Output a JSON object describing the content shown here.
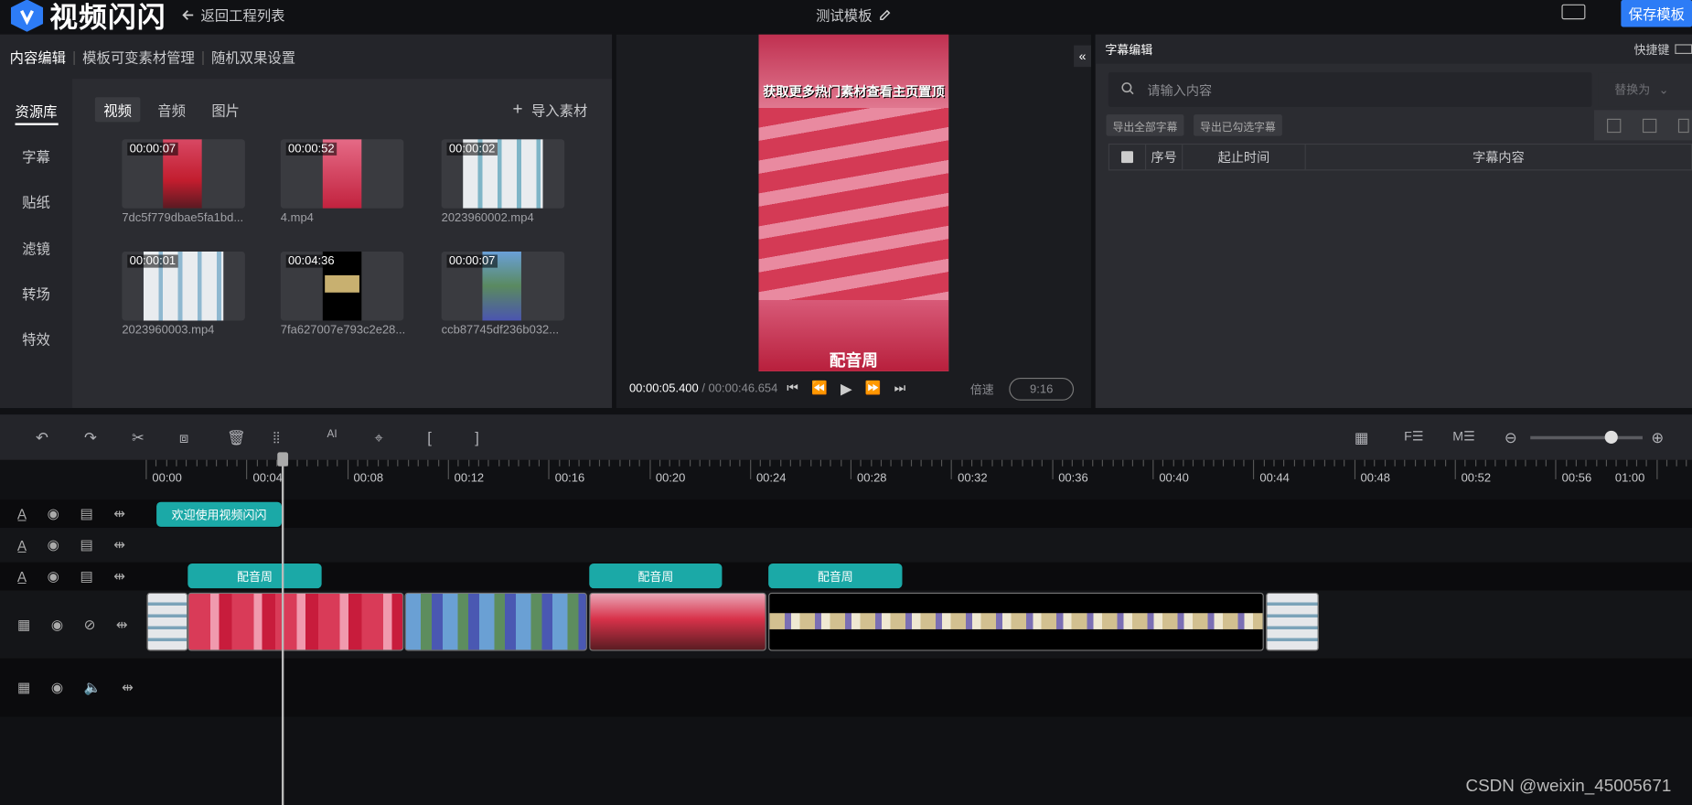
{
  "app": {
    "name": "视频闪闪",
    "back_label": "返回工程列表",
    "project_name": "测试模板",
    "save_label": "保存模板"
  },
  "left_tabs": [
    "内容编辑",
    "模板可变素材管理",
    "随机双果设置"
  ],
  "side_nav": [
    "资源库",
    "字幕",
    "贴纸",
    "滤镜",
    "转场",
    "特效"
  ],
  "media_tabs": [
    "视频",
    "音频",
    "图片"
  ],
  "import_label": "导入素材",
  "media": [
    {
      "duration": "00:00:07",
      "name": "7dc5f779dbae5fa1bd..."
    },
    {
      "duration": "00:00:52",
      "name": "4.mp4"
    },
    {
      "duration": "00:00:02",
      "name": "2023960002.mp4"
    },
    {
      "duration": "00:00:01",
      "name": "2023960003.mp4"
    },
    {
      "duration": "00:04:36",
      "name": "7fa627007e793c2e28..."
    },
    {
      "duration": "00:00:07",
      "name": "ccb87745df236b032..."
    }
  ],
  "preview": {
    "caption_top": "获取更多热门素材查看主页置顶",
    "caption_bottom": "配音周",
    "current_time": "00:00:05.400",
    "separator": " / ",
    "total_time": "00:00:46.654",
    "speed_label": "倍速",
    "ratio": "9:16"
  },
  "subtitle_panel": {
    "title": "字幕编辑",
    "shortcut": "快捷键",
    "search_placeholder": "请输入内容",
    "replace_label": "替换为",
    "export_all": "导出全部字幕",
    "export_selected": "导出已勾选字幕",
    "columns": [
      "序号",
      "起止时间",
      "字幕内容"
    ]
  },
  "ruler_labels": [
    "00:00",
    "00:04",
    "00:08",
    "00:12",
    "00:16",
    "00:20",
    "00:24",
    "00:28",
    "00:32",
    "00:36",
    "00:40",
    "00:44",
    "00:48",
    "00:52",
    "00:56",
    "01:00"
  ],
  "tracks": {
    "text1_clip": "欢迎使用视频闪闪",
    "dub_clip_1": "配音周",
    "dub_clip_2": "配音周",
    "dub_clip_3": "配音周"
  },
  "watermark": "CSDN @weixin_45005671",
  "colors": {
    "accent": "#2d7cf6",
    "clip": "#1ba9a7",
    "bg": "#101114",
    "panel": "#2b2c31"
  }
}
